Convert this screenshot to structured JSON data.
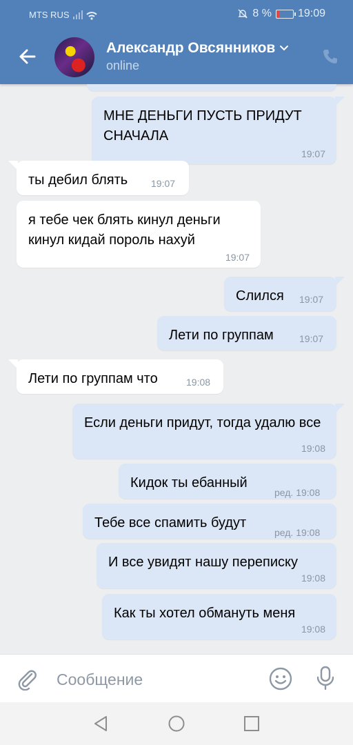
{
  "status_bar": {
    "carrier": "MTS RUS",
    "battery": "8 %",
    "time": "19:09"
  },
  "header": {
    "contact_name": "Александр Овсянников",
    "presence": "online"
  },
  "messages": [
    {
      "dir": "out",
      "text": "МНЕ ДЕНЬГИ ПУСТЬ ПРИДУТ СНАЧАЛА",
      "time": "19:07"
    },
    {
      "dir": "in",
      "text": "ты дебил блять",
      "time": "19:07"
    },
    {
      "dir": "in",
      "text": "я тебе чек блять кинул деньги кинул кидай пороль нахуй",
      "time": "19:07"
    },
    {
      "dir": "out",
      "text": "Слился",
      "time": "19:07"
    },
    {
      "dir": "out",
      "text": "Лети по группам",
      "time": "19:07"
    },
    {
      "dir": "in",
      "text": "Лети по группам что",
      "time": "19:08"
    },
    {
      "dir": "out",
      "text": "Если деньги придут, тогда удалю все",
      "time": "19:08"
    },
    {
      "dir": "out",
      "text": "Кидок ты ебанный",
      "time": "ред. 19:08"
    },
    {
      "dir": "out",
      "text": "Тебе все спамить будут",
      "time": "ред. 19:08"
    },
    {
      "dir": "out",
      "text": "И все увидят нашу переписку",
      "time": "19:08"
    },
    {
      "dir": "out",
      "text": "Как ты хотел обмануть меня",
      "time": "19:08"
    }
  ],
  "composer": {
    "placeholder": "Сообщение"
  },
  "colors": {
    "header": "#5181b8",
    "outgoing_bubble": "#dbe6f6",
    "incoming_bubble": "#ffffff",
    "chat_bg": "#edeef0"
  },
  "icons": [
    "back-arrow-icon",
    "chevron-down-icon",
    "phone-icon",
    "paperclip-icon",
    "smile-icon",
    "mic-icon",
    "nav-back-icon",
    "nav-home-icon",
    "nav-recents-icon"
  ]
}
